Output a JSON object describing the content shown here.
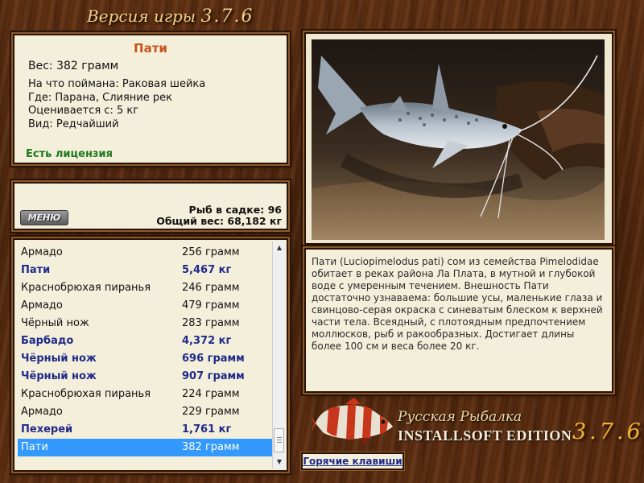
{
  "header": {
    "version_label": "Версия игры",
    "version_number": "3.7.6"
  },
  "fish_info": {
    "name": "Пати",
    "weight": "Вес: 382 грамм",
    "caught_on": "На что поймана: Раковая шейка",
    "location": "Где: Парана, Слияние рек",
    "rated_from": "Оценивается с: 5 кг",
    "rarity": "Вид: Редчайший",
    "license": "Есть лицензия"
  },
  "menu_panel": {
    "menu_label": "МЕНЮ",
    "fish_count": "Рыб в садке: 96",
    "total_weight": "Общий вес: 68,182 кг"
  },
  "catch_list": [
    {
      "name": "Армадо",
      "weight": "256 грамм",
      "trophy": false,
      "selected": false
    },
    {
      "name": "Пати",
      "weight": "5,467 кг",
      "trophy": true,
      "selected": false
    },
    {
      "name": "Краснобрюхая пиранья",
      "weight": "246 грамм",
      "trophy": false,
      "selected": false
    },
    {
      "name": "Армадо",
      "weight": "479 грамм",
      "trophy": false,
      "selected": false
    },
    {
      "name": "Чёрный нож",
      "weight": "283 грамм",
      "trophy": false,
      "selected": false
    },
    {
      "name": "Барбадо",
      "weight": "4,372 кг",
      "trophy": true,
      "selected": false
    },
    {
      "name": "Чёрный нож",
      "weight": "696 грамм",
      "trophy": true,
      "selected": false
    },
    {
      "name": "Чёрный нож",
      "weight": "907 грамм",
      "trophy": true,
      "selected": false
    },
    {
      "name": "Краснобрюхая пиранья",
      "weight": "224 грамм",
      "trophy": false,
      "selected": false
    },
    {
      "name": "Армадо",
      "weight": "229 грамм",
      "trophy": false,
      "selected": false
    },
    {
      "name": "Пехерей",
      "weight": "1,761 кг",
      "trophy": true,
      "selected": false
    },
    {
      "name": "Пати",
      "weight": "382 грамм",
      "trophy": false,
      "selected": true
    }
  ],
  "description": "Пати (Luciopimelodus pati) сом из семейства Pimelodidae обитает в реках района Ла Плата, в мутной и глубокой воде с умеренным течением. Внешность Пати достаточно узнаваема: большие усы, маленькие глаза и свинцово-серая окраска с синеватым блеском к верхней части тела. Всеядный, с плотоядным предпочтением моллюсков, рыб и ракообразных. Достигает длины более 100 см и веса более 20 кг.",
  "logo": {
    "title": "Русская Рыбалка",
    "edition": "INSTALLSOFT EDITION",
    "version": "3.7.6"
  },
  "hotkeys_label": "Горячие клавиши",
  "colors": {
    "fish_name": "#c8521a",
    "license": "#1c7a1c",
    "trophy_text": "#1f2a8a",
    "selection": "#3399ff",
    "panel_bg": "#f4efda"
  },
  "icons": {
    "scroll_up": "triangle-up-icon",
    "scroll_down": "triangle-down-icon"
  }
}
